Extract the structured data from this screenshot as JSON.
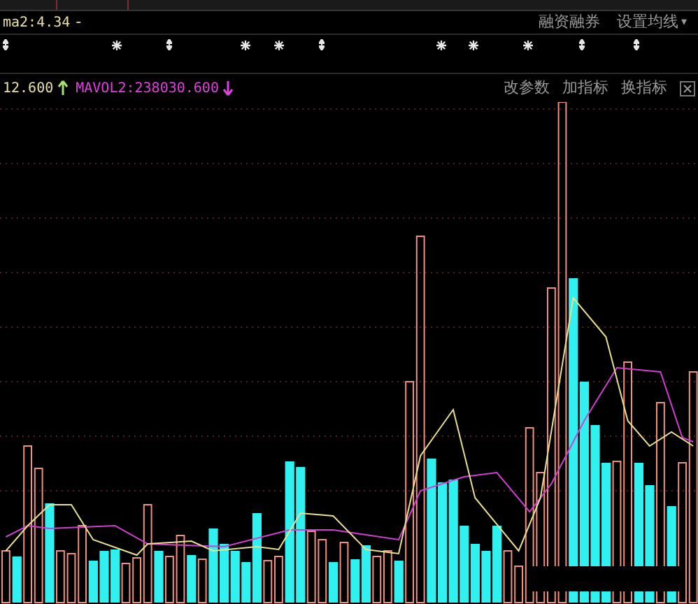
{
  "top_row": {
    "ma_label": "ma2:4.34",
    "dash": "-",
    "links": [
      "融资融券",
      "设置均线"
    ],
    "dropdown": "▾"
  },
  "markers": [
    {
      "kind": "arrow"
    },
    {
      "kind": "star"
    },
    {
      "kind": "arrow"
    },
    {
      "kind": "star"
    },
    {
      "kind": "star"
    },
    {
      "kind": "arrow"
    },
    {
      "kind": "star"
    },
    {
      "kind": "star"
    },
    {
      "kind": "star"
    },
    {
      "kind": "arrow"
    },
    {
      "kind": "arrow"
    }
  ],
  "indicator_row": {
    "value": "12.600",
    "value_rising": true,
    "mavol": "MAVOL2:238030.600",
    "mavol_rising": false,
    "actions": [
      "改参数",
      "加指标",
      "换指标"
    ]
  }
}
